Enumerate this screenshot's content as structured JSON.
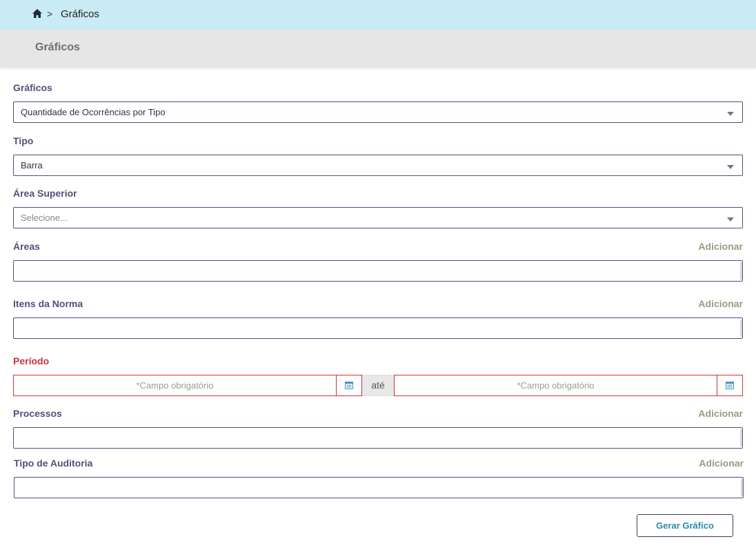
{
  "breadcrumb": {
    "home_icon": "home-icon",
    "separator": ">",
    "current": "Gráficos"
  },
  "page": {
    "title": "Gráficos"
  },
  "form": {
    "graficos": {
      "label": "Gráficos",
      "value": "Quantidade de Ocorrências por Tipo"
    },
    "tipo": {
      "label": "Tipo",
      "value": "Barra"
    },
    "area_superior": {
      "label": "Área Superior",
      "placeholder": "Selecione..."
    },
    "areas": {
      "label": "Áreas",
      "add_label": "Adicionar"
    },
    "itens_norma": {
      "label": "Itens da Norma",
      "add_label": "Adicionar"
    },
    "periodo": {
      "label": "Período",
      "start_placeholder": "*Campo obrigatório",
      "separator": "até",
      "end_placeholder": "*Campo obrigatório",
      "calendar_icon": "calendar-icon"
    },
    "processos": {
      "label": "Processos",
      "add_label": "Adicionar"
    },
    "tipo_auditoria": {
      "label": "Tipo de Auditoria",
      "add_label": "Adicionar"
    },
    "submit_label": "Gerar Gráfico"
  },
  "colors": {
    "breadcrumb_bg": "#c8ebf4",
    "title_bar_bg": "#e6e6e6",
    "label": "#5a4a7a",
    "required": "#c8323c",
    "add_link": "#9a9a80",
    "button_text": "#2a8ab0"
  }
}
